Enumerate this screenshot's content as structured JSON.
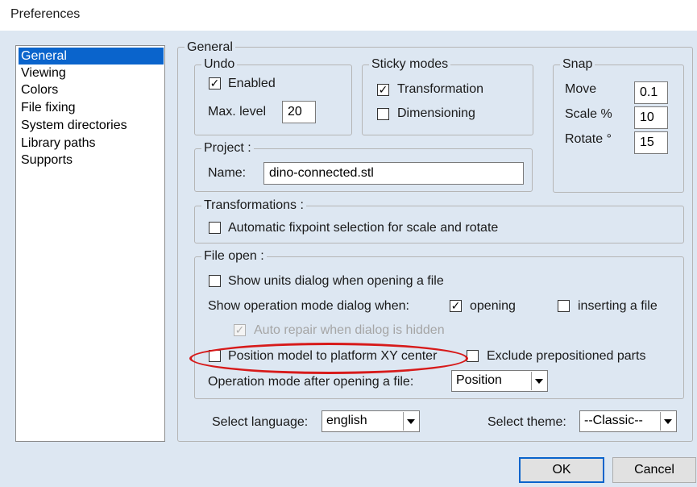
{
  "window": {
    "title": "Preferences"
  },
  "nav": {
    "items": [
      {
        "label": "General",
        "selected": true
      },
      {
        "label": "Viewing",
        "selected": false
      },
      {
        "label": "Colors",
        "selected": false
      },
      {
        "label": "File fixing",
        "selected": false
      },
      {
        "label": "System directories",
        "selected": false
      },
      {
        "label": "Library paths",
        "selected": false
      },
      {
        "label": "Supports",
        "selected": false
      }
    ]
  },
  "general": {
    "legend": "General",
    "undo": {
      "legend": "Undo",
      "enabled_label": "Enabled",
      "enabled_checked": true,
      "max_level_label": "Max. level",
      "max_level_value": "20"
    },
    "sticky": {
      "legend": "Sticky modes",
      "transformation_label": "Transformation",
      "transformation_checked": true,
      "dimensioning_label": "Dimensioning",
      "dimensioning_checked": false
    },
    "snap": {
      "legend": "Snap",
      "move_label": "Move",
      "move_value": "0.1",
      "scale_label": "Scale %",
      "scale_value": "10",
      "rotate_label": "Rotate °",
      "rotate_value": "15"
    },
    "project": {
      "legend": "Project :",
      "name_label": "Name:",
      "name_value": "dino-connected.stl"
    },
    "transformations": {
      "legend": "Transformations :",
      "auto_fixpoint_label": "Automatic fixpoint selection for scale and rotate",
      "auto_fixpoint_checked": false
    },
    "file_open": {
      "legend": "File open :",
      "show_units_label": "Show units dialog when opening a file",
      "show_units_checked": false,
      "show_op_mode_label": "Show operation mode dialog when:",
      "opening_label": "opening",
      "opening_checked": true,
      "inserting_label": "inserting a file",
      "inserting_checked": false,
      "auto_repair_label": "Auto repair when dialog is hidden",
      "auto_repair_checked": true,
      "position_center_label": "Position model to platform XY center",
      "position_center_checked": false,
      "exclude_prepositioned_label": "Exclude prepositioned parts",
      "exclude_prepositioned_checked": false,
      "op_mode_after_label": "Operation mode after opening a file:",
      "op_mode_after_value": "Position"
    }
  },
  "language": {
    "label": "Select language:",
    "value": "english"
  },
  "theme": {
    "label": "Select theme:",
    "value": "--Classic--"
  },
  "buttons": {
    "ok": "OK",
    "cancel": "Cancel"
  },
  "colors": {
    "selection": "#0a64cc",
    "highlight_ellipse": "#d71a1a",
    "panel_bg": "#dde7f2"
  }
}
